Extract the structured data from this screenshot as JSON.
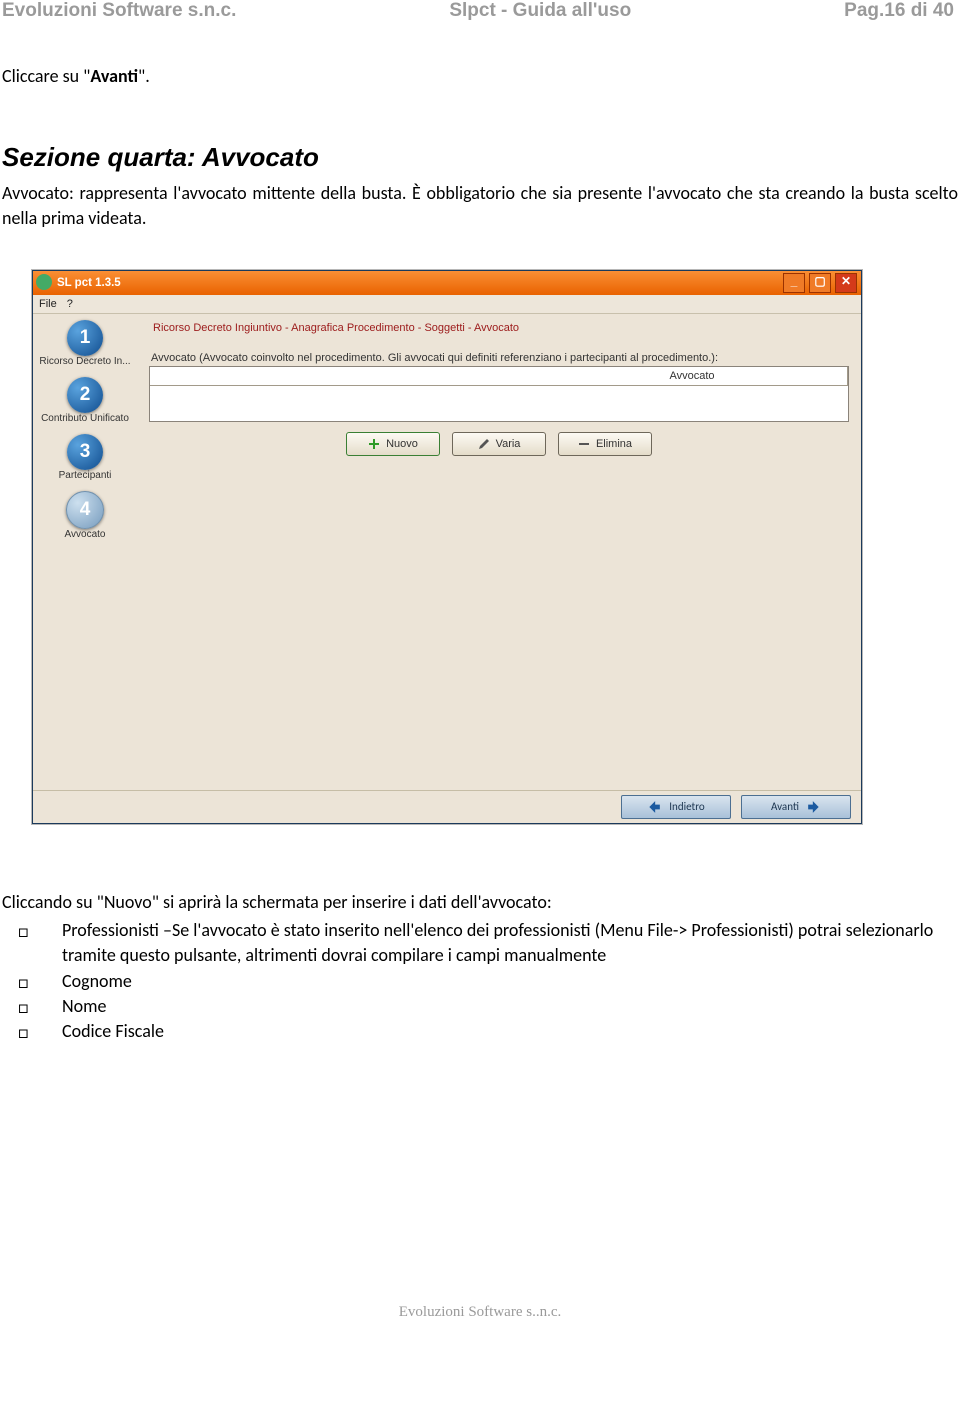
{
  "header": {
    "company": "Evoluzioni Software s.n.c.",
    "doc_title": "Slpct - Guida all'uso",
    "page_indicator": "Pag.16 di 40"
  },
  "intro_line": {
    "prefix": "Cliccare su \"",
    "bold": "Avanti",
    "suffix": "\"."
  },
  "section_title": "Sezione quarta: Avvocato",
  "paragraph": {
    "lead_bold": "Avvocato:",
    "part1": " rappresenta l'avvocato ",
    "mid_bold": "mittente della busta. È obbligatorio che sia presente l'avvocato che sta creando la busta scelto nella prima videata."
  },
  "app": {
    "title": "SL pct 1.3.5",
    "menu": {
      "file": "File",
      "help": "?"
    },
    "breadcrumb": "Ricorso Decreto Ingiuntivo - Anagrafica Procedimento - Soggetti - Avvocato",
    "field_label": "Avvocato (Avvocato coinvolto nel procedimento. Gli avvocati qui definiti referenziano i partecipanti al procedimento.):",
    "table_column": "Avvocato",
    "buttons": {
      "nuovo": "Nuovo",
      "varia": "Varia",
      "elimina": "Elimina"
    },
    "nav": {
      "indietro": "Indietro",
      "avanti": "Avanti"
    },
    "steps": [
      {
        "num": "1",
        "label": "Ricorso Decreto In..."
      },
      {
        "num": "2",
        "label": "Contributo Unificato"
      },
      {
        "num": "3",
        "label": "Partecipanti"
      },
      {
        "num": "4",
        "label": "Avvocato"
      }
    ]
  },
  "post_text": {
    "prefix": "Cliccando su \"",
    "bold": "Nuovo",
    "suffix": "\" si aprirà la schermata per inserire i dati dell'avvocato:"
  },
  "bullets": [
    {
      "bold": "Professionisti",
      "rest": " –Se l'avvocato è stato inserito nell'elenco dei professionisti (Menu File-> Professionisti) potrai selezionarlo tramite questo pulsante, altrimenti dovrai compilare i campi manualmente"
    },
    {
      "bold": "Cognome",
      "rest": ""
    },
    {
      "bold": "Nome",
      "rest": ""
    },
    {
      "bold": "Codice Fiscale",
      "rest": ""
    }
  ],
  "footer": "Evoluzioni Software s..n.c."
}
